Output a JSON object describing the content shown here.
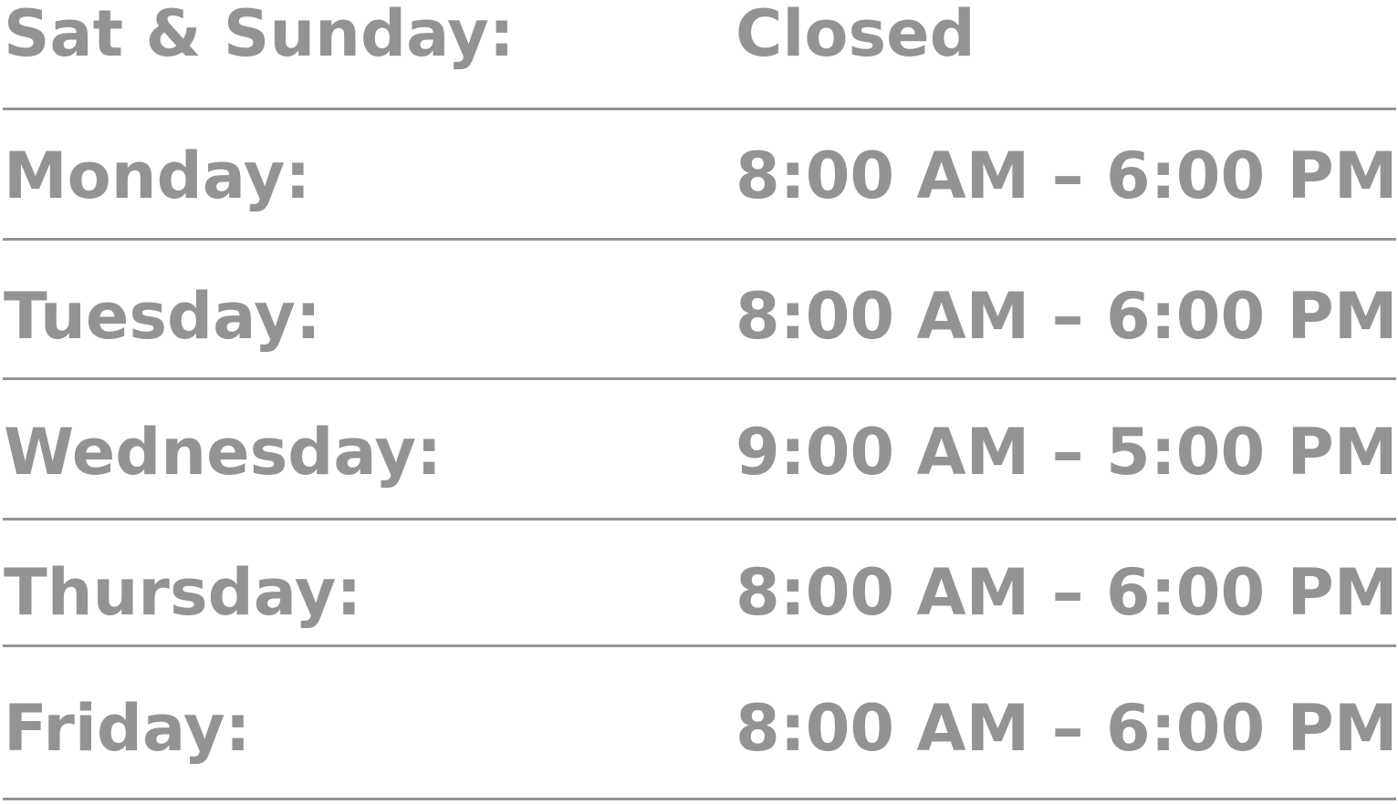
{
  "hours": [
    {
      "day": "Sat & Sunday:",
      "time": "Closed"
    },
    {
      "day": "Monday:",
      "time": "8:00 AM – 6:00 PM"
    },
    {
      "day": "Tuesday:",
      "time": "8:00 AM – 6:00 PM"
    },
    {
      "day": "Wednesday:",
      "time": "9:00 AM – 5:00 PM"
    },
    {
      "day": "Thursday:",
      "time": "8:00 AM – 6:00 PM"
    },
    {
      "day": "Friday:",
      "time": "8:00 AM – 6:00 PM"
    }
  ],
  "colors": {
    "text": "#939393",
    "divider": "#939393",
    "background": "#ffffff"
  }
}
